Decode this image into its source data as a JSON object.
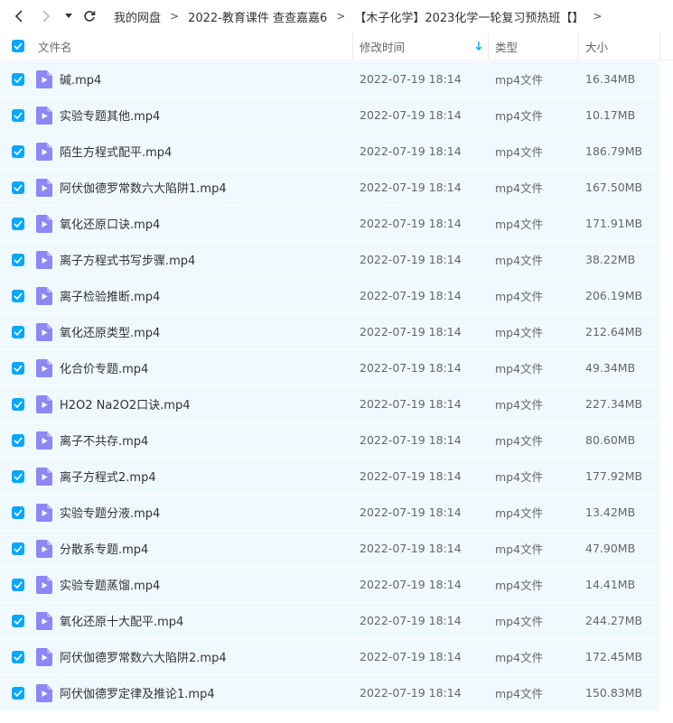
{
  "breadcrumb": [
    "我的网盘",
    "2022-教育课件 查查嘉嘉6",
    "【木子化学】2023化学一轮复习预热班【】"
  ],
  "breadcrumb_sep": ">",
  "columns": {
    "name": "文件名",
    "time": "修改时间",
    "type": "类型",
    "size": "大小"
  },
  "colors": {
    "accent": "#06a7ff",
    "row_selected": "#f0f9fe",
    "file_icon": "#8c86f6"
  },
  "files": [
    {
      "name": "碱.mp4",
      "time": "2022-07-19 18:14",
      "type": "mp4文件",
      "size": "16.34MB"
    },
    {
      "name": "实验专题其他.mp4",
      "time": "2022-07-19 18:14",
      "type": "mp4文件",
      "size": "10.17MB"
    },
    {
      "name": "陌生方程式配平.mp4",
      "time": "2022-07-19 18:14",
      "type": "mp4文件",
      "size": "186.79MB"
    },
    {
      "name": "阿伏伽德罗常数六大陷阱1.mp4",
      "time": "2022-07-19 18:14",
      "type": "mp4文件",
      "size": "167.50MB"
    },
    {
      "name": "氧化还原口诀.mp4",
      "time": "2022-07-19 18:14",
      "type": "mp4文件",
      "size": "171.91MB"
    },
    {
      "name": "离子方程式书写步骤.mp4",
      "time": "2022-07-19 18:14",
      "type": "mp4文件",
      "size": "38.22MB"
    },
    {
      "name": "离子检验推断.mp4",
      "time": "2022-07-19 18:14",
      "type": "mp4文件",
      "size": "206.19MB"
    },
    {
      "name": "氧化还原类型.mp4",
      "time": "2022-07-19 18:14",
      "type": "mp4文件",
      "size": "212.64MB"
    },
    {
      "name": "化合价专题.mp4",
      "time": "2022-07-19 18:14",
      "type": "mp4文件",
      "size": "49.34MB"
    },
    {
      "name": "H2O2 Na2O2口诀.mp4",
      "time": "2022-07-19 18:14",
      "type": "mp4文件",
      "size": "227.34MB"
    },
    {
      "name": "离子不共存.mp4",
      "time": "2022-07-19 18:14",
      "type": "mp4文件",
      "size": "80.60MB"
    },
    {
      "name": "离子方程式2.mp4",
      "time": "2022-07-19 18:14",
      "type": "mp4文件",
      "size": "177.92MB"
    },
    {
      "name": "实验专题分液.mp4",
      "time": "2022-07-19 18:14",
      "type": "mp4文件",
      "size": "13.42MB"
    },
    {
      "name": "分散系专题.mp4",
      "time": "2022-07-19 18:14",
      "type": "mp4文件",
      "size": "47.90MB"
    },
    {
      "name": "实验专题蒸馏.mp4",
      "time": "2022-07-19 18:14",
      "type": "mp4文件",
      "size": "14.41MB"
    },
    {
      "name": "氧化还原十大配平.mp4",
      "time": "2022-07-19 18:14",
      "type": "mp4文件",
      "size": "244.27MB"
    },
    {
      "name": "阿伏伽德罗常数六大陷阱2.mp4",
      "time": "2022-07-19 18:14",
      "type": "mp4文件",
      "size": "172.45MB"
    },
    {
      "name": "阿伏伽德罗定律及推论1.mp4",
      "time": "2022-07-19 18:14",
      "type": "mp4文件",
      "size": "150.83MB"
    }
  ]
}
